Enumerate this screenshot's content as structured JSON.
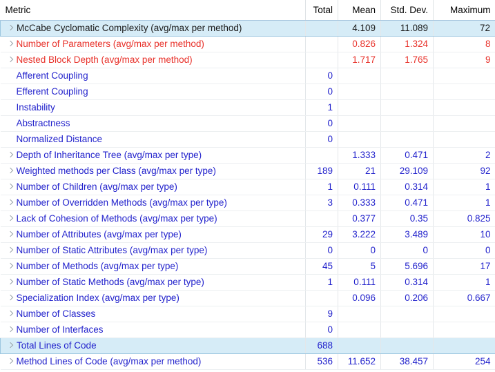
{
  "table": {
    "columns": [
      {
        "key": "metric",
        "label": "Metric",
        "align": "left"
      },
      {
        "key": "total",
        "label": "Total",
        "align": "right"
      },
      {
        "key": "mean",
        "label": "Mean",
        "align": "right"
      },
      {
        "key": "stddev",
        "label": "Std. Dev.",
        "align": "right"
      },
      {
        "key": "maximum",
        "label": "Maximum",
        "align": "right"
      }
    ],
    "colors": {
      "blue": "#2222cc",
      "red": "#e8312a",
      "header_text": "#000000",
      "selection_background": "#d6ecf7",
      "selection_border": "#9cc6e0",
      "grid_line": "#e3e7ea",
      "row_line": "#eceff1",
      "twisty": "#9aa3a9"
    },
    "rows": [
      {
        "metric": "McCabe Cyclomatic Complexity (avg/max per method)",
        "total": "",
        "mean": "4.109",
        "stddev": "11.089",
        "maximum": "72",
        "color": "black",
        "expandable": true,
        "selected": true
      },
      {
        "metric": "Number of Parameters (avg/max per method)",
        "total": "",
        "mean": "0.826",
        "stddev": "1.324",
        "maximum": "8",
        "color": "red",
        "expandable": true,
        "selected": false
      },
      {
        "metric": "Nested Block Depth (avg/max per method)",
        "total": "",
        "mean": "1.717",
        "stddev": "1.765",
        "maximum": "9",
        "color": "red",
        "expandable": true,
        "selected": false
      },
      {
        "metric": "Afferent Coupling",
        "total": "0",
        "mean": "",
        "stddev": "",
        "maximum": "",
        "color": "blue",
        "expandable": false,
        "selected": false
      },
      {
        "metric": "Efferent Coupling",
        "total": "0",
        "mean": "",
        "stddev": "",
        "maximum": "",
        "color": "blue",
        "expandable": false,
        "selected": false
      },
      {
        "metric": "Instability",
        "total": "1",
        "mean": "",
        "stddev": "",
        "maximum": "",
        "color": "blue",
        "expandable": false,
        "selected": false
      },
      {
        "metric": "Abstractness",
        "total": "0",
        "mean": "",
        "stddev": "",
        "maximum": "",
        "color": "blue",
        "expandable": false,
        "selected": false
      },
      {
        "metric": "Normalized Distance",
        "total": "0",
        "mean": "",
        "stddev": "",
        "maximum": "",
        "color": "blue",
        "expandable": false,
        "selected": false
      },
      {
        "metric": "Depth of Inheritance Tree (avg/max per type)",
        "total": "",
        "mean": "1.333",
        "stddev": "0.471",
        "maximum": "2",
        "color": "blue",
        "expandable": true,
        "selected": false
      },
      {
        "metric": "Weighted methods per Class (avg/max per type)",
        "total": "189",
        "mean": "21",
        "stddev": "29.109",
        "maximum": "92",
        "color": "blue",
        "expandable": true,
        "selected": false
      },
      {
        "metric": "Number of Children (avg/max per type)",
        "total": "1",
        "mean": "0.111",
        "stddev": "0.314",
        "maximum": "1",
        "color": "blue",
        "expandable": true,
        "selected": false
      },
      {
        "metric": "Number of Overridden Methods (avg/max per type)",
        "total": "3",
        "mean": "0.333",
        "stddev": "0.471",
        "maximum": "1",
        "color": "blue",
        "expandable": true,
        "selected": false
      },
      {
        "metric": "Lack of Cohesion of Methods (avg/max per type)",
        "total": "",
        "mean": "0.377",
        "stddev": "0.35",
        "maximum": "0.825",
        "color": "blue",
        "expandable": true,
        "selected": false
      },
      {
        "metric": "Number of Attributes (avg/max per type)",
        "total": "29",
        "mean": "3.222",
        "stddev": "3.489",
        "maximum": "10",
        "color": "blue",
        "expandable": true,
        "selected": false
      },
      {
        "metric": "Number of Static Attributes (avg/max per type)",
        "total": "0",
        "mean": "0",
        "stddev": "0",
        "maximum": "0",
        "color": "blue",
        "expandable": true,
        "selected": false
      },
      {
        "metric": "Number of Methods (avg/max per type)",
        "total": "45",
        "mean": "5",
        "stddev": "5.696",
        "maximum": "17",
        "color": "blue",
        "expandable": true,
        "selected": false
      },
      {
        "metric": "Number of Static Methods (avg/max per type)",
        "total": "1",
        "mean": "0.111",
        "stddev": "0.314",
        "maximum": "1",
        "color": "blue",
        "expandable": true,
        "selected": false
      },
      {
        "metric": "Specialization Index (avg/max per type)",
        "total": "",
        "mean": "0.096",
        "stddev": "0.206",
        "maximum": "0.667",
        "color": "blue",
        "expandable": true,
        "selected": false
      },
      {
        "metric": "Number of Classes",
        "total": "9",
        "mean": "",
        "stddev": "",
        "maximum": "",
        "color": "blue",
        "expandable": true,
        "selected": false
      },
      {
        "metric": "Number of Interfaces",
        "total": "0",
        "mean": "",
        "stddev": "",
        "maximum": "",
        "color": "blue",
        "expandable": true,
        "selected": false
      },
      {
        "metric": "Total Lines of Code",
        "total": "688",
        "mean": "",
        "stddev": "",
        "maximum": "",
        "color": "blue",
        "expandable": true,
        "selected": true
      },
      {
        "metric": "Method Lines of Code (avg/max per method)",
        "total": "536",
        "mean": "11.652",
        "stddev": "38.457",
        "maximum": "254",
        "color": "blue",
        "expandable": true,
        "selected": false
      }
    ]
  }
}
